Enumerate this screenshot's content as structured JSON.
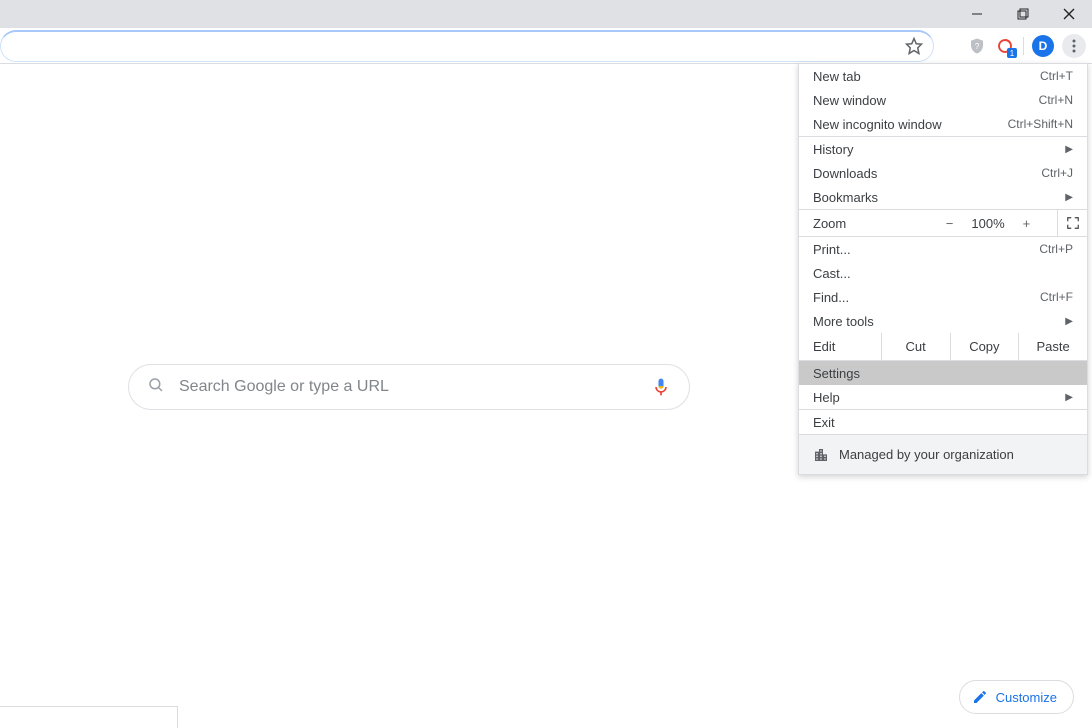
{
  "window": {
    "avatar_letter": "D"
  },
  "search": {
    "placeholder": "Search Google or type a URL"
  },
  "customize": {
    "label": "Customize"
  },
  "menu": {
    "new_tab": {
      "label": "New tab",
      "shortcut": "Ctrl+T"
    },
    "new_window": {
      "label": "New window",
      "shortcut": "Ctrl+N"
    },
    "incognito": {
      "label": "New incognito window",
      "shortcut": "Ctrl+Shift+N"
    },
    "history": {
      "label": "History"
    },
    "downloads": {
      "label": "Downloads",
      "shortcut": "Ctrl+J"
    },
    "bookmarks": {
      "label": "Bookmarks"
    },
    "zoom": {
      "label": "Zoom",
      "value": "100%",
      "minus": "−",
      "plus": "+"
    },
    "print": {
      "label": "Print...",
      "shortcut": "Ctrl+P"
    },
    "cast": {
      "label": "Cast..."
    },
    "find": {
      "label": "Find...",
      "shortcut": "Ctrl+F"
    },
    "more_tools": {
      "label": "More tools"
    },
    "edit": {
      "label": "Edit",
      "cut": "Cut",
      "copy": "Copy",
      "paste": "Paste"
    },
    "settings": {
      "label": "Settings"
    },
    "help": {
      "label": "Help"
    },
    "exit": {
      "label": "Exit"
    },
    "managed": {
      "label": "Managed by your organization"
    }
  }
}
